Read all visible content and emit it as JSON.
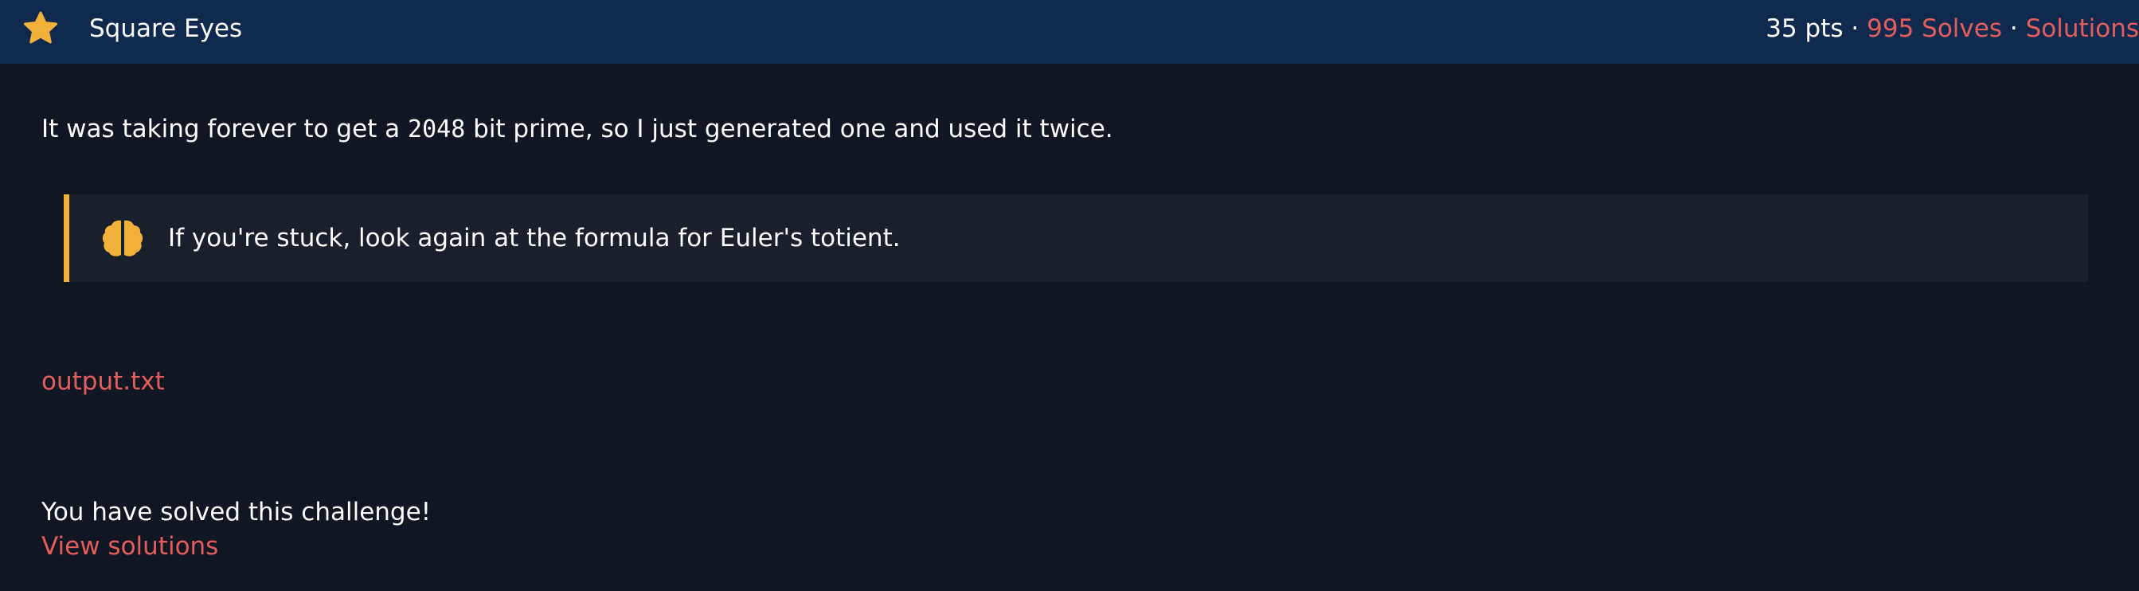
{
  "challenge": {
    "title": "Square Eyes",
    "points": "35 pts",
    "separator": "·",
    "solves_label": "995 Solves",
    "solutions_label": "Solutions"
  },
  "description": {
    "before": "It was taking forever to get a ",
    "number": "2048",
    "after": " bit prime, so I just generated one and used it twice."
  },
  "hint": {
    "icon": "brain-icon",
    "text": "If you're stuck, look again at the formula for Euler's totient."
  },
  "files": {
    "output_label": "output.txt"
  },
  "status": {
    "solved_text": "You have solved this challenge!",
    "view_solutions_label": "View solutions"
  },
  "colors": {
    "header_bg": "#102a4f",
    "page_bg": "#111623",
    "accent_link": "#e35d5d",
    "star": "#f2b13a",
    "hint_border": "#f2b13a"
  }
}
